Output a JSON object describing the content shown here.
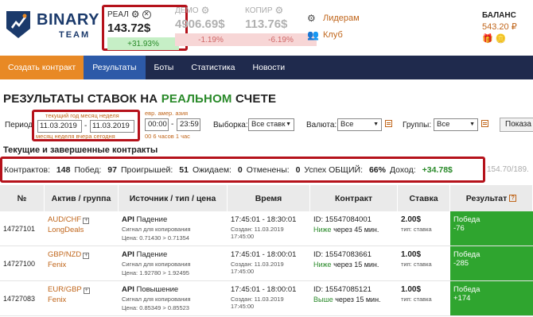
{
  "logo": {
    "brand": "BINARY",
    "sub": "TEAM"
  },
  "accounts": [
    {
      "title": "РЕАЛ",
      "amount": "143.72$",
      "pct": "+31.93%"
    },
    {
      "title": "ДЕМО",
      "amount": "4906.69$",
      "pct": "-1.19%"
    },
    {
      "title": "КОПИР",
      "amount": "113.76$",
      "pct": "-6.19%"
    }
  ],
  "side_links": {
    "leaders": "Лидерам",
    "club": "Клуб"
  },
  "balance": {
    "label": "БАЛАНС",
    "value": "543.20 ₽"
  },
  "nav": {
    "create": "Создать контракт",
    "results": "Результаты",
    "bots": "Боты",
    "stats": "Статистика",
    "news": "Новости"
  },
  "page_title": {
    "part1": "РЕЗУЛЬТАТЫ СТАВОК НА ",
    "part2": "РЕАЛЬНОМ",
    "part3": " СЧЕТЕ"
  },
  "filters": {
    "period_label": "Период:",
    "quick_top": "текущий год  месяц  неделя",
    "quick_bottom": "месяц  неделя  вчера  сегодня",
    "date_from": "11.03.2019",
    "date_to": "11.03.2019",
    "time_quick_top": "евр.  амер.  азия",
    "time_from": "00:00",
    "time_to": "23:59",
    "time_quick_bottom": "00   6 часов   1 час",
    "sample_label": "Выборка:",
    "sample_value": "Все ставк",
    "currency_label": "Валюта:",
    "currency_value": "Все",
    "groups_label": "Группы:",
    "groups_value": "Все",
    "show_button": "Показа"
  },
  "section_title": "Текущие и завершенные контракты",
  "stats": {
    "contracts_label": "Контрактов:",
    "contracts": "148",
    "wins_label": "Побед:",
    "wins": "97",
    "losses_label": "Проигрышей:",
    "losses": "51",
    "waiting_label": "Ожидаем:",
    "waiting": "0",
    "cancelled_label": "Отменены:",
    "cancelled": "0",
    "success_label": "Успех ОБЩИЙ:",
    "success": "66%",
    "income_label": "Доход:",
    "income": "+34.78$",
    "extra": "154.70/189."
  },
  "table": {
    "headers": {
      "num": "№",
      "asset": "Актив / группа",
      "source": "Источник / тип / цена",
      "time": "Время",
      "contract": "Контракт",
      "bet": "Ставка",
      "result": "Результат"
    },
    "rows": [
      {
        "id": "14727101",
        "asset": "AUD/CHF",
        "group": "LongDeals",
        "source": "API",
        "type": "Падение",
        "signal": "Сигнал для копирования",
        "price": "Цена: 0.71430 > 0.71354",
        "time": "17:45:01 - 18:30:01",
        "created": "Создан: 11.03.2019 17:45:00",
        "contract_id": "ID: 15547084001",
        "dir": "Ниже",
        "dir_rest": " через 45 мин.",
        "bet": "2.00$",
        "bet_type": "тип: ставка",
        "result": "Победа",
        "result_val": "-76"
      },
      {
        "id": "14727100",
        "asset": "GBP/NZD",
        "group": "Fenix",
        "source": "API",
        "type": "Падение",
        "signal": "Сигнал для копирования",
        "price": "Цена: 1.92780 > 1.92495",
        "time": "17:45:01 - 18:00:01",
        "created": "Создан: 11.03.2019 17:45:00",
        "contract_id": "ID: 15547083661",
        "dir": "Ниже",
        "dir_rest": " через 15 мин.",
        "bet": "1.00$",
        "bet_type": "тип: ставка",
        "result": "Победа",
        "result_val": "-285"
      },
      {
        "id": "14727083",
        "asset": "EUR/GBP",
        "group": "Fenix",
        "source": "API",
        "type": "Повышение",
        "signal": "Сигнал для копирования",
        "price": "Цена: 0.85349 > 0.85523",
        "time": "17:45:01 - 18:00:01",
        "created": "Создан: 11.03.2019 17:45:00",
        "contract_id": "ID: 15547085121",
        "dir": "Выше",
        "dir_rest": " через 15 мин.",
        "bet": "1.00$",
        "bet_type": "тип: ставка",
        "result": "Победа",
        "result_val": "+174"
      }
    ]
  }
}
